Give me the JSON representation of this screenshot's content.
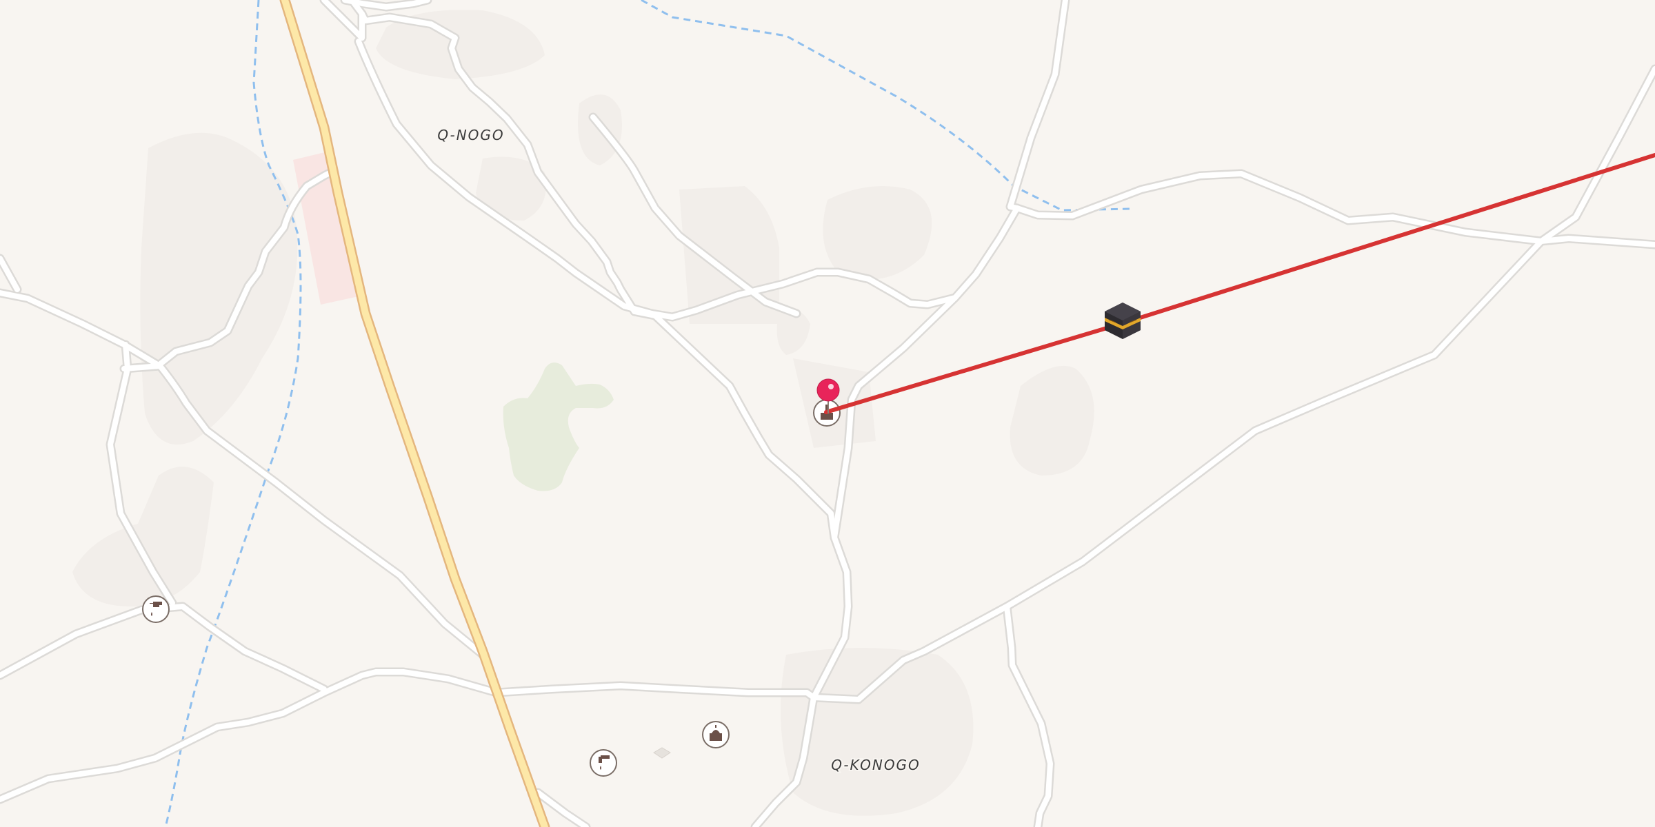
{
  "map": {
    "labels": {
      "q_nogo": "Q-NOGO",
      "q_konogo": "Q-KONOGO"
    },
    "colors": {
      "background": "#f8f5f1",
      "road_casing": "#dcdad7",
      "road_fill": "#ffffff",
      "primary_road_casing": "#e4b67e",
      "primary_road_fill": "#fde8a8",
      "waterway": "#8fbfee",
      "route": "#d63333",
      "marker": "#e8245a",
      "poi_icon": "#6b5048",
      "vegetation": "#e7ecdc",
      "landuse_residential": "#f1ece7",
      "landuse_commercial": "#f9e5e3"
    },
    "pois": [
      {
        "name": "water-tap-icon"
      },
      {
        "name": "water-tap-icon"
      },
      {
        "name": "mosque-icon"
      },
      {
        "name": "mosque-icon"
      },
      {
        "name": "kaaba-icon"
      }
    ]
  }
}
